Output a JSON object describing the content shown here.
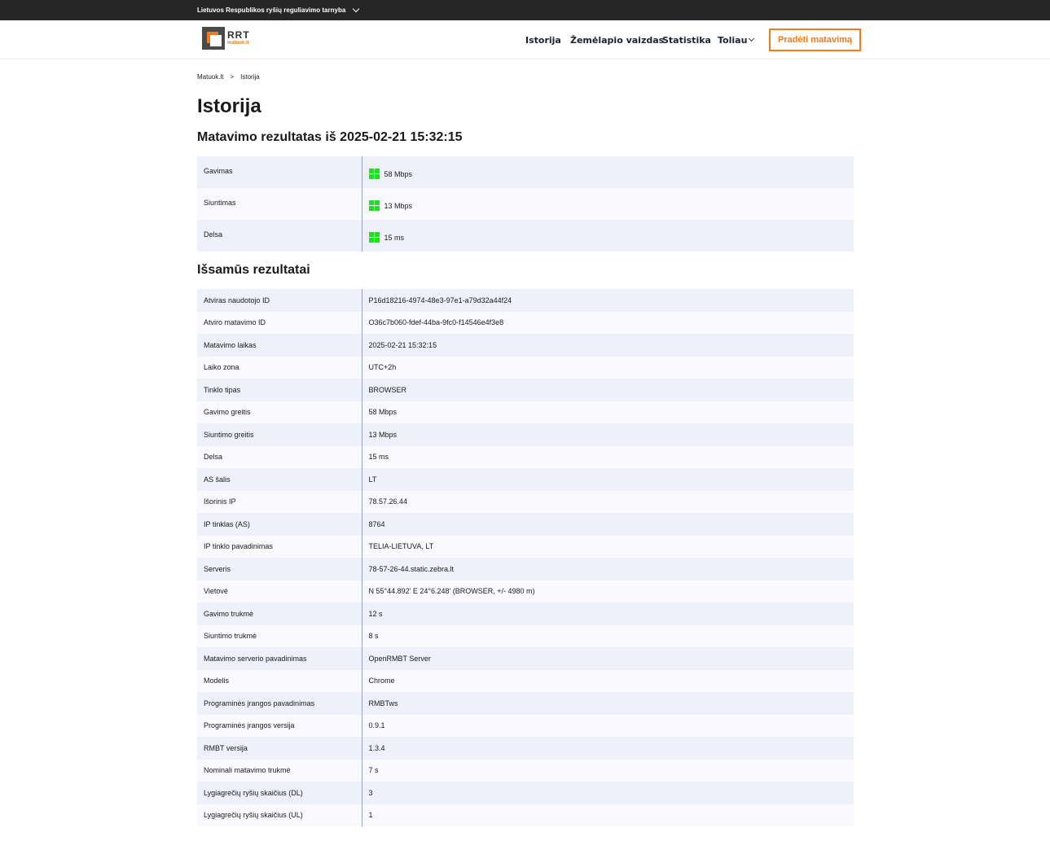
{
  "topbar": {
    "org": "Lietuvos Respublikos ryšių reguliavimo tarnyba"
  },
  "logo": {
    "mark": "RRT",
    "sub": "matuok.lt"
  },
  "nav": {
    "items": [
      "Istorija",
      "Žemėlapio vaizdas",
      "Statistika",
      "Toliau"
    ],
    "cta": "Pradėti matavimą"
  },
  "breadcrumb": {
    "home": "Matuok.lt",
    "sep": ">",
    "current": "Istorija"
  },
  "page_title": "Istorija",
  "result_heading": "Matavimo rezultatas iš 2025-02-21 15:32:15",
  "summary": [
    {
      "label": "Gavimas",
      "value": "58 Mbps"
    },
    {
      "label": "Siuntimas",
      "value": "13 Mbps"
    },
    {
      "label": "Delsa",
      "value": "15 ms"
    }
  ],
  "details_heading": "Išsamūs rezultatai",
  "details": [
    {
      "label": "Atviras naudotojo ID",
      "value": "P16d18216-4974-48e3-97e1-a79d32a44f24"
    },
    {
      "label": "Atviro matavimo ID",
      "value": "O36c7b060-fdef-44ba-9fc0-f14546e4f3e8"
    },
    {
      "label": "Matavimo laikas",
      "value": "2025-02-21 15:32:15"
    },
    {
      "label": "Laiko zona",
      "value": "UTC+2h"
    },
    {
      "label": "Tinklo tipas",
      "value": "BROWSER"
    },
    {
      "label": "Gavimo greitis",
      "value": "58 Mbps"
    },
    {
      "label": "Siuntimo greitis",
      "value": "13 Mbps"
    },
    {
      "label": "Delsa",
      "value": "15 ms"
    },
    {
      "label": "AS šalis",
      "value": "LT"
    },
    {
      "label": "Išorinis IP",
      "value": "78.57.26.44"
    },
    {
      "label": "IP tinklas (AS)",
      "value": "8764"
    },
    {
      "label": "IP tinklo pavadinimas",
      "value": "TELIA-LIETUVA, LT"
    },
    {
      "label": "Serveris",
      "value": "78-57-26-44.static.zebra.lt"
    },
    {
      "label": "Vietovė",
      "value": "N 55°44.892' E 24°6.248' (BROWSER, +/- 4980 m)"
    },
    {
      "label": "Gavimo trukmė",
      "value": "12 s"
    },
    {
      "label": "Siuntimo trukmė",
      "value": "8 s"
    },
    {
      "label": "Matavimo serverio pavadinimas",
      "value": "OpenRMBT Server"
    },
    {
      "label": "Modelis",
      "value": "Chrome"
    },
    {
      "label": "Programinės įrangos pavadinimas",
      "value": "RMBTws"
    },
    {
      "label": "Programinės įrangos versija",
      "value": "0.9.1"
    },
    {
      "label": "RMBT versija",
      "value": "1.3.4"
    },
    {
      "label": "Nominali matavimo trukmė",
      "value": "7 s"
    },
    {
      "label": "Lygiagrečių ryšių skaičius (DL)",
      "value": "3"
    },
    {
      "label": "Lygiagrečių ryšių skaičius (UL)",
      "value": "1"
    }
  ],
  "colors": {
    "accent": "#f07b1d",
    "good": "#22dd22",
    "topbar": "#262626"
  }
}
